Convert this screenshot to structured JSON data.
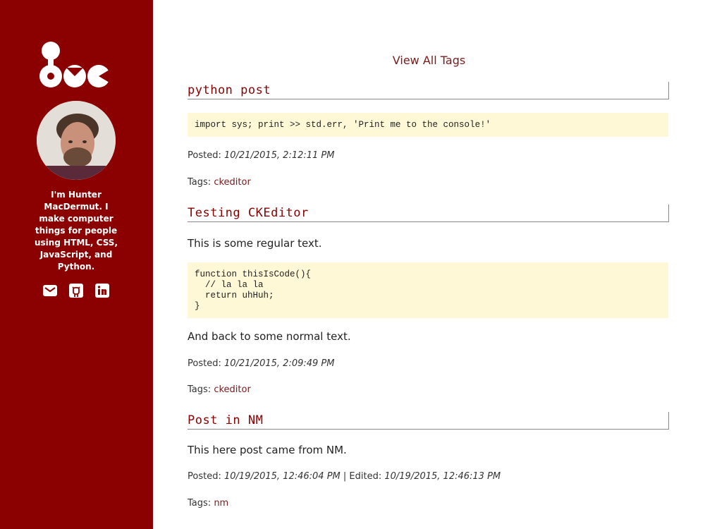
{
  "sidebar": {
    "bio": "I'm Hunter MacDermut. I make computer things for people using HTML, CSS, JavaScript, and Python.",
    "social": [
      "mail-icon",
      "github-icon",
      "linkedin-icon"
    ],
    "colors": {
      "sidebar_bg": "#8b0000",
      "text": "#ffffff"
    }
  },
  "header": {
    "view_all_tags": "View All Tags"
  },
  "posts": [
    {
      "title": "python post",
      "code": "import sys; print >> std.err, 'Print me to the console!'",
      "posted_label": "Posted:",
      "posted": "10/21/2015, 2:12:11 PM",
      "tags_label": "Tags:",
      "tag": "ckeditor"
    },
    {
      "title": "Testing CKEditor",
      "text1": "This is some regular text.",
      "code": "function thisIsCode(){\n  // la la la\n  return uhHuh;\n}",
      "text2": "And back to some normal text.",
      "posted_label": "Posted:",
      "posted": "10/21/2015, 2:09:49 PM",
      "tags_label": "Tags:",
      "tag": "ckeditor"
    },
    {
      "title": "Post in NM",
      "text1": "This here post came from NM.",
      "posted_label": "Posted:",
      "posted": "10/19/2015, 12:46:04 PM",
      "edited_sep": " | Edited:",
      "edited": "10/19/2015, 12:46:13 PM",
      "tags_label": "Tags:",
      "tag": "nm"
    }
  ],
  "colors": {
    "accent": "#8b0000",
    "link": "#7a1a1a",
    "code_bg": "#fff8d6"
  }
}
